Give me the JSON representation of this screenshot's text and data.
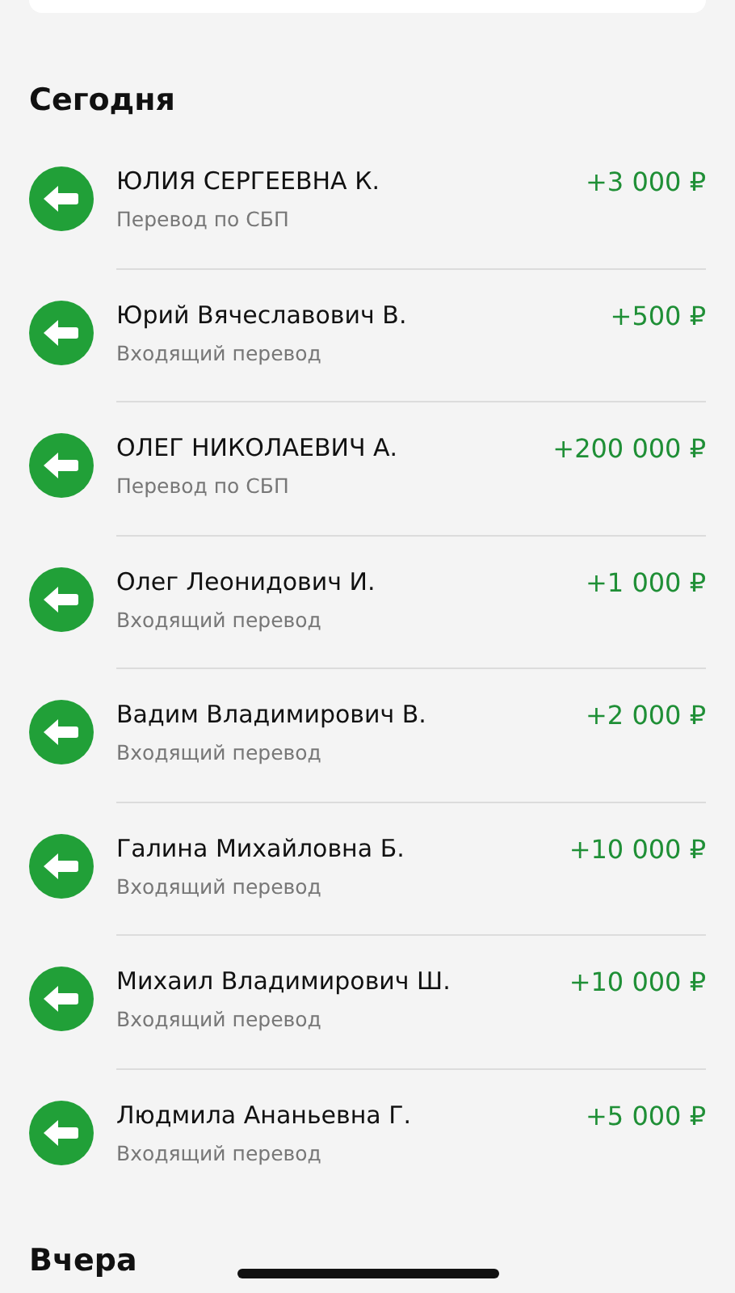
{
  "sections": [
    {
      "title": "Сегодня",
      "transactions": [
        {
          "name": "ЮЛИЯ СЕРГЕЕВНА К.",
          "subtitle": "Перевод по СБП",
          "amount": "+3 000 ₽"
        },
        {
          "name": "Юрий Вячеславович В.",
          "subtitle": "Входящий перевод",
          "amount": "+500 ₽"
        },
        {
          "name": "ОЛЕГ НИКОЛАЕВИЧ А.",
          "subtitle": "Перевод по СБП",
          "amount": "+200 000 ₽"
        },
        {
          "name": "Олег Леонидович И.",
          "subtitle": "Входящий перевод",
          "amount": "+1 000 ₽"
        },
        {
          "name": "Вадим Владимирович В.",
          "subtitle": "Входящий перевод",
          "amount": "+2 000 ₽"
        },
        {
          "name": "Галина Михайловна Б.",
          "subtitle": "Входящий перевод",
          "amount": "+10 000 ₽"
        },
        {
          "name": "Михаил Владимирович Ш.",
          "subtitle": "Входящий перевод",
          "amount": "+10 000 ₽"
        },
        {
          "name": "Людмила Ананьевна Г.",
          "subtitle": "Входящий перевод",
          "amount": "+5 000 ₽"
        }
      ]
    },
    {
      "title": "Вчера"
    }
  ]
}
